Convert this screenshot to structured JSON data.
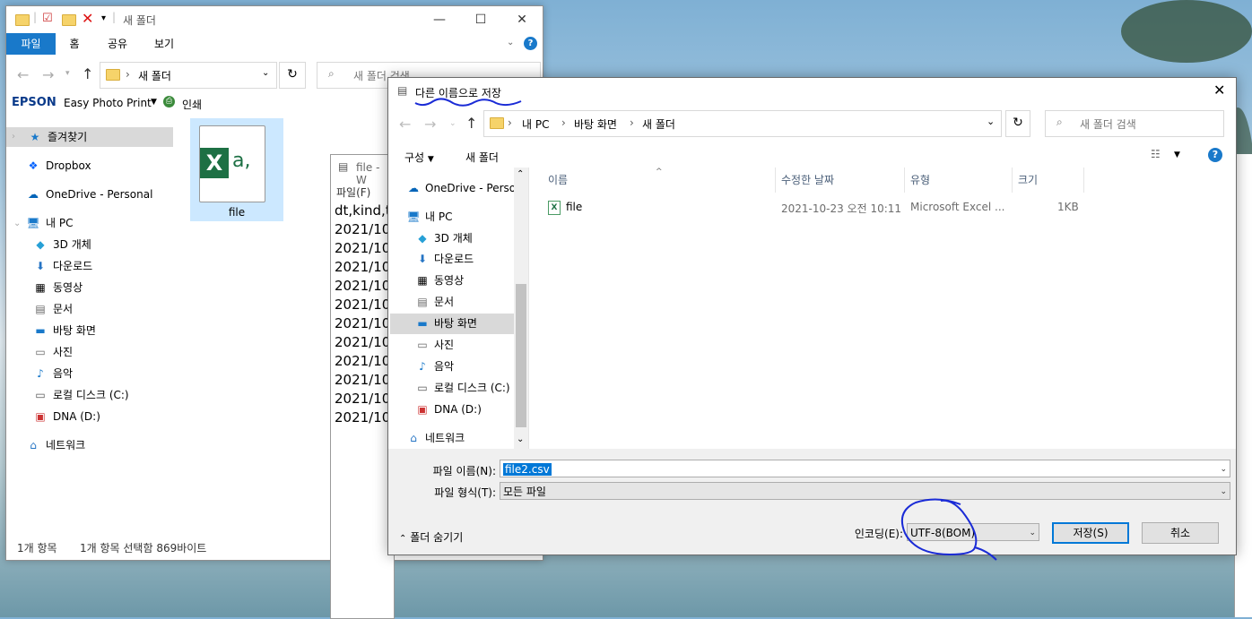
{
  "explorer": {
    "title": "새 폴더",
    "ribbon_tabs": [
      "파일",
      "홈",
      "공유",
      "보기"
    ],
    "address_path": "새 폴더",
    "search_placeholder": "새 폴더 검색",
    "epson_brand": "EPSON",
    "epson_app": "Easy Photo Print",
    "print_label": "인쇄",
    "nav": {
      "favorites": "즐겨찾기",
      "dropbox": "Dropbox",
      "onedrive": "OneDrive - Personal",
      "this_pc": "내 PC",
      "objects3d": "3D 개체",
      "downloads": "다운로드",
      "videos": "동영상",
      "documents": "문서",
      "desktop": "바탕 화면",
      "pictures": "사진",
      "music": "음악",
      "local_disk": "로컬 디스크 (C:)",
      "dna": "DNA (D:)",
      "network": "네트워크"
    },
    "file_name": "file",
    "status_count": "1개 항목",
    "status_selected": "1개 항목 선택함 869바이트"
  },
  "notepad": {
    "title": "file - W",
    "menu": "파일(F)",
    "lines": [
      "dt,kind,t",
      "2021/10",
      "2021/10",
      "2021/10",
      "2021/10",
      "2021/10",
      "2021/10",
      "2021/10",
      "2021/10",
      "2021/10",
      "2021/10",
      "2021/10"
    ]
  },
  "dialog": {
    "title": "다른 이름으로 저장",
    "breadcrumb": [
      "내 PC",
      "바탕 화면",
      "새 폴더"
    ],
    "search_placeholder": "새 폴더 검색",
    "organize": "구성",
    "new_folder": "새 폴더",
    "nav": {
      "onedrive": "OneDrive - Perso",
      "this_pc": "내 PC",
      "objects3d": "3D 개체",
      "downloads": "다운로드",
      "videos": "동영상",
      "documents": "문서",
      "desktop": "바탕 화면",
      "pictures": "사진",
      "music": "음악",
      "local_disk": "로컬 디스크 (C:)",
      "dna": "DNA (D:)",
      "network": "네트워크"
    },
    "columns": {
      "name": "이름",
      "modified": "수정한 날짜",
      "type": "유형",
      "size": "크기"
    },
    "files": [
      {
        "name": "file",
        "modified": "2021-10-23 오전 10:11",
        "type": "Microsoft Excel ...",
        "size": "1KB"
      }
    ],
    "filename_label": "파일 이름(N):",
    "filename_value": "file2.csv",
    "filetype_label": "파일 형식(T):",
    "filetype_value": "모든 파일",
    "hide_folders": "폴더 숨기기",
    "encoding_label": "인코딩(E):",
    "encoding_value": "UTF-8(BOM)",
    "save_button": "저장(S)",
    "cancel_button": "취소"
  },
  "colors": {
    "accent": "#1979ca",
    "annotation": "#1a2bd6",
    "selection": "#cce8ff"
  }
}
